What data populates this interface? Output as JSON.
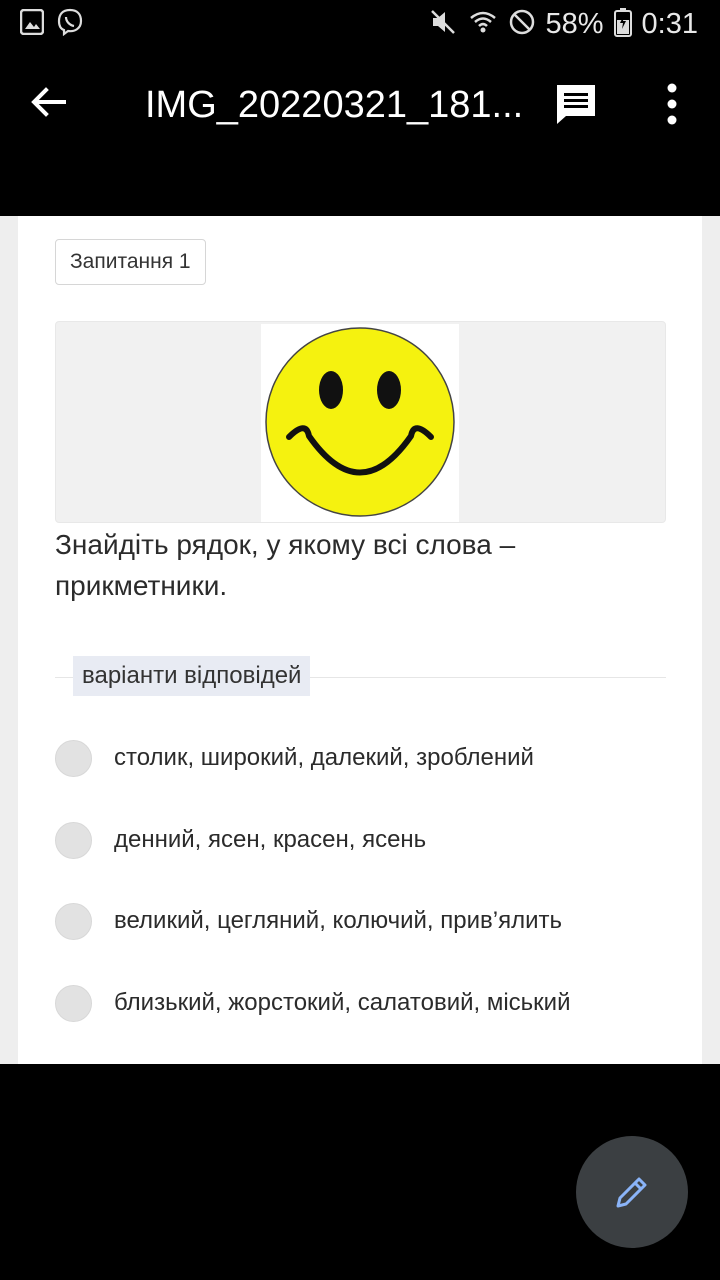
{
  "status_bar": {
    "battery": "58%",
    "time": "0:31"
  },
  "app_bar": {
    "title": "IMG_20220321_181..."
  },
  "content": {
    "question_chip": "Запитання 1",
    "question_text": "Знайдіть рядок, у якому всі слова – прикметники.",
    "answers_label": "варіанти відповідей",
    "options": [
      "столик, широкий, далекий, зроблений",
      "денний, ясен, красен, ясень",
      "великий, цегляний, колючий, прив’ялить",
      "близький, жорстокий, салатовий, міський"
    ]
  },
  "colors": {
    "background": "#000000",
    "page": "#ffffff",
    "smiley_yellow": "#f5f20f",
    "fab": "#3b3f42",
    "fab_icon": "#8ab4f8"
  }
}
